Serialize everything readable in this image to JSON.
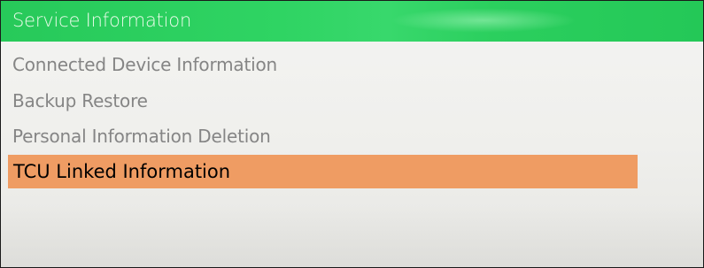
{
  "header": {
    "title": "Service Information"
  },
  "menu": {
    "items": [
      {
        "label": "Connected Device Information",
        "selected": false
      },
      {
        "label": "Backup Restore",
        "selected": false
      },
      {
        "label": "Personal Information Deletion",
        "selected": false
      },
      {
        "label": "TCU Linked Information",
        "selected": true
      }
    ]
  },
  "colors": {
    "header_bg": "#2fd463",
    "header_text": "#e9fbe9",
    "selected_bg": "#ef9c63",
    "item_text": "#858585",
    "selected_text": "#000000"
  }
}
